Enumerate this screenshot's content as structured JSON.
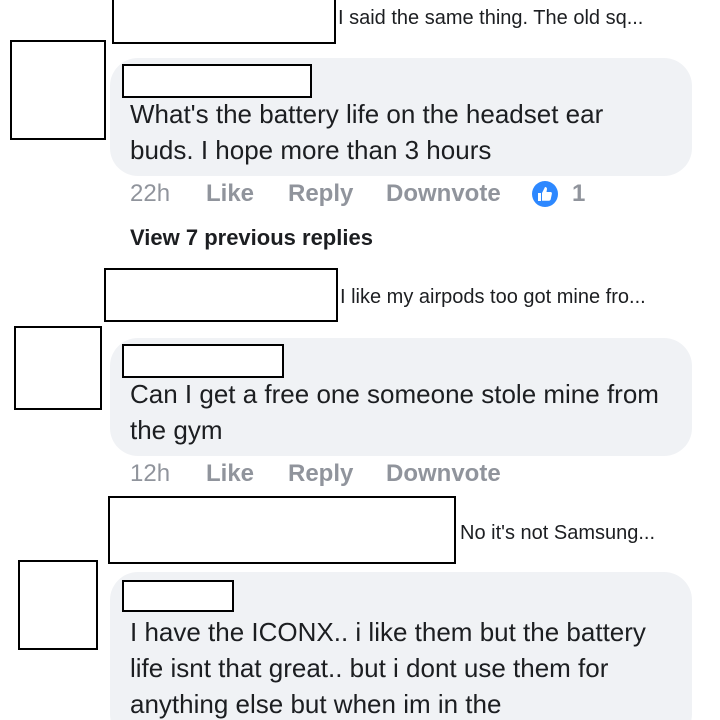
{
  "thread": {
    "reply_previews": [
      {
        "text": "I said the same thing. The old sq..."
      },
      {
        "text": "I like my airpods too got mine fro..."
      },
      {
        "text": "No it's not Samsung..."
      }
    ],
    "comments": [
      {
        "text": "What's the battery life on the headset ear buds. I hope more than 3 hours",
        "time": "22h",
        "like_label": "Like",
        "reply_label": "Reply",
        "downvote_label": "Downvote",
        "reaction_icon": "thumbs-up-icon",
        "reaction_count": "1"
      },
      {
        "text": "Can I get a free one someone stole mine from the gym",
        "time": "12h",
        "like_label": "Like",
        "reply_label": "Reply",
        "downvote_label": "Downvote"
      },
      {
        "text": "I have the ICONX.. i like them but the battery life isnt that great.. but i dont use them for anything else but when im in the"
      }
    ],
    "view_previous_replies": "View 7 previous replies"
  },
  "colors": {
    "bubble_bg": "#f0f2f5",
    "meta_text": "#90949c",
    "like_blue": "#2d88ff",
    "text_primary": "#1c1e21"
  }
}
